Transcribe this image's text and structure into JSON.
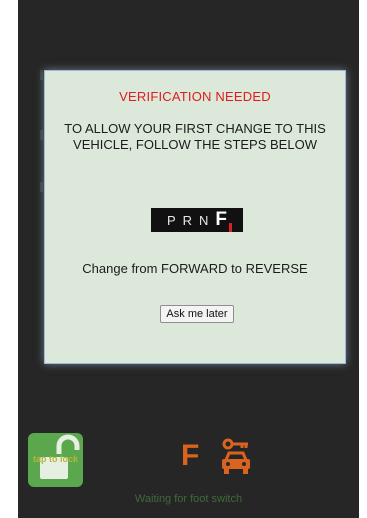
{
  "dialog": {
    "title": "VERIFICATION NEEDED",
    "message": "TO ALLOW YOUR FIRST CHANGE TO THIS VEHICLE, FOLLOW THE STEPS BELOW",
    "gear_selector": {
      "gears": [
        "P",
        "R",
        "N"
      ],
      "active_gear": "F"
    },
    "instruction": "Change from FORWARD to REVERSE",
    "later_button": "Ask me later"
  },
  "bottom": {
    "lock_button_label": "tap to lock",
    "current_gear": "F",
    "status": "Waiting for foot switch"
  },
  "colors": {
    "title_red": "#e11c1c",
    "dialog_bg": "#dce8da",
    "app_bg": "#262626",
    "gear_orange": "#d9631f",
    "lock_green": "#5aa74d",
    "status_green": "#3f6a3a"
  },
  "icons": [
    "unlocked-padlock-icon",
    "car-with-key-icon"
  ]
}
